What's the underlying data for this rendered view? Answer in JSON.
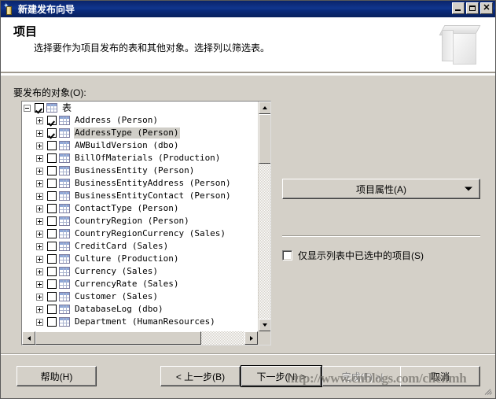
{
  "window": {
    "title": "新建发布向导",
    "icon": "wizard-icon",
    "minimize_label": "最小化",
    "maximize_label": "最大化",
    "close_label": "关闭"
  },
  "header": {
    "title": "项目",
    "subtitle": "选择要作为项目发布的表和其他对象。选择列以筛选表。"
  },
  "main": {
    "objects_label": "要发布的对象(O):",
    "article_properties_button": "项目属性(A)",
    "show_only_checked_label": "仅显示列表中已选中的项目(S)",
    "show_only_checked_checked": false
  },
  "tree": {
    "root": {
      "label": "表",
      "checked": true,
      "expanded": true
    },
    "items": [
      {
        "label": "Address (Person)",
        "checked": true,
        "selected": false
      },
      {
        "label": "AddressType (Person)",
        "checked": true,
        "selected": true
      },
      {
        "label": "AWBuildVersion (dbo)",
        "checked": false,
        "selected": false
      },
      {
        "label": "BillOfMaterials (Production)",
        "checked": false,
        "selected": false
      },
      {
        "label": "BusinessEntity (Person)",
        "checked": false,
        "selected": false
      },
      {
        "label": "BusinessEntityAddress (Person)",
        "checked": false,
        "selected": false
      },
      {
        "label": "BusinessEntityContact (Person)",
        "checked": false,
        "selected": false
      },
      {
        "label": "ContactType (Person)",
        "checked": false,
        "selected": false
      },
      {
        "label": "CountryRegion (Person)",
        "checked": false,
        "selected": false
      },
      {
        "label": "CountryRegionCurrency (Sales)",
        "checked": false,
        "selected": false
      },
      {
        "label": "CreditCard (Sales)",
        "checked": false,
        "selected": false
      },
      {
        "label": "Culture (Production)",
        "checked": false,
        "selected": false
      },
      {
        "label": "Currency (Sales)",
        "checked": false,
        "selected": false
      },
      {
        "label": "CurrencyRate (Sales)",
        "checked": false,
        "selected": false
      },
      {
        "label": "Customer (Sales)",
        "checked": false,
        "selected": false
      },
      {
        "label": "DatabaseLog (dbo)",
        "checked": false,
        "selected": false
      },
      {
        "label": "Department (HumanResources)",
        "checked": false,
        "selected": false
      }
    ]
  },
  "footer": {
    "help": "帮助(H)",
    "back": "< 上一步(B)",
    "next": "下一步(N) >",
    "finish": "完成(F) >|",
    "finish_disabled": true,
    "cancel": "取消"
  },
  "watermark": "http://www.cnblogs.com/chenmh",
  "colors": {
    "dialog_face": "#d4d0c8",
    "titlebar_start": "#0a246a",
    "titlebar_end": "#08205c",
    "selection": "#d0cec8",
    "table_icon_header": "#8fa8d8"
  }
}
